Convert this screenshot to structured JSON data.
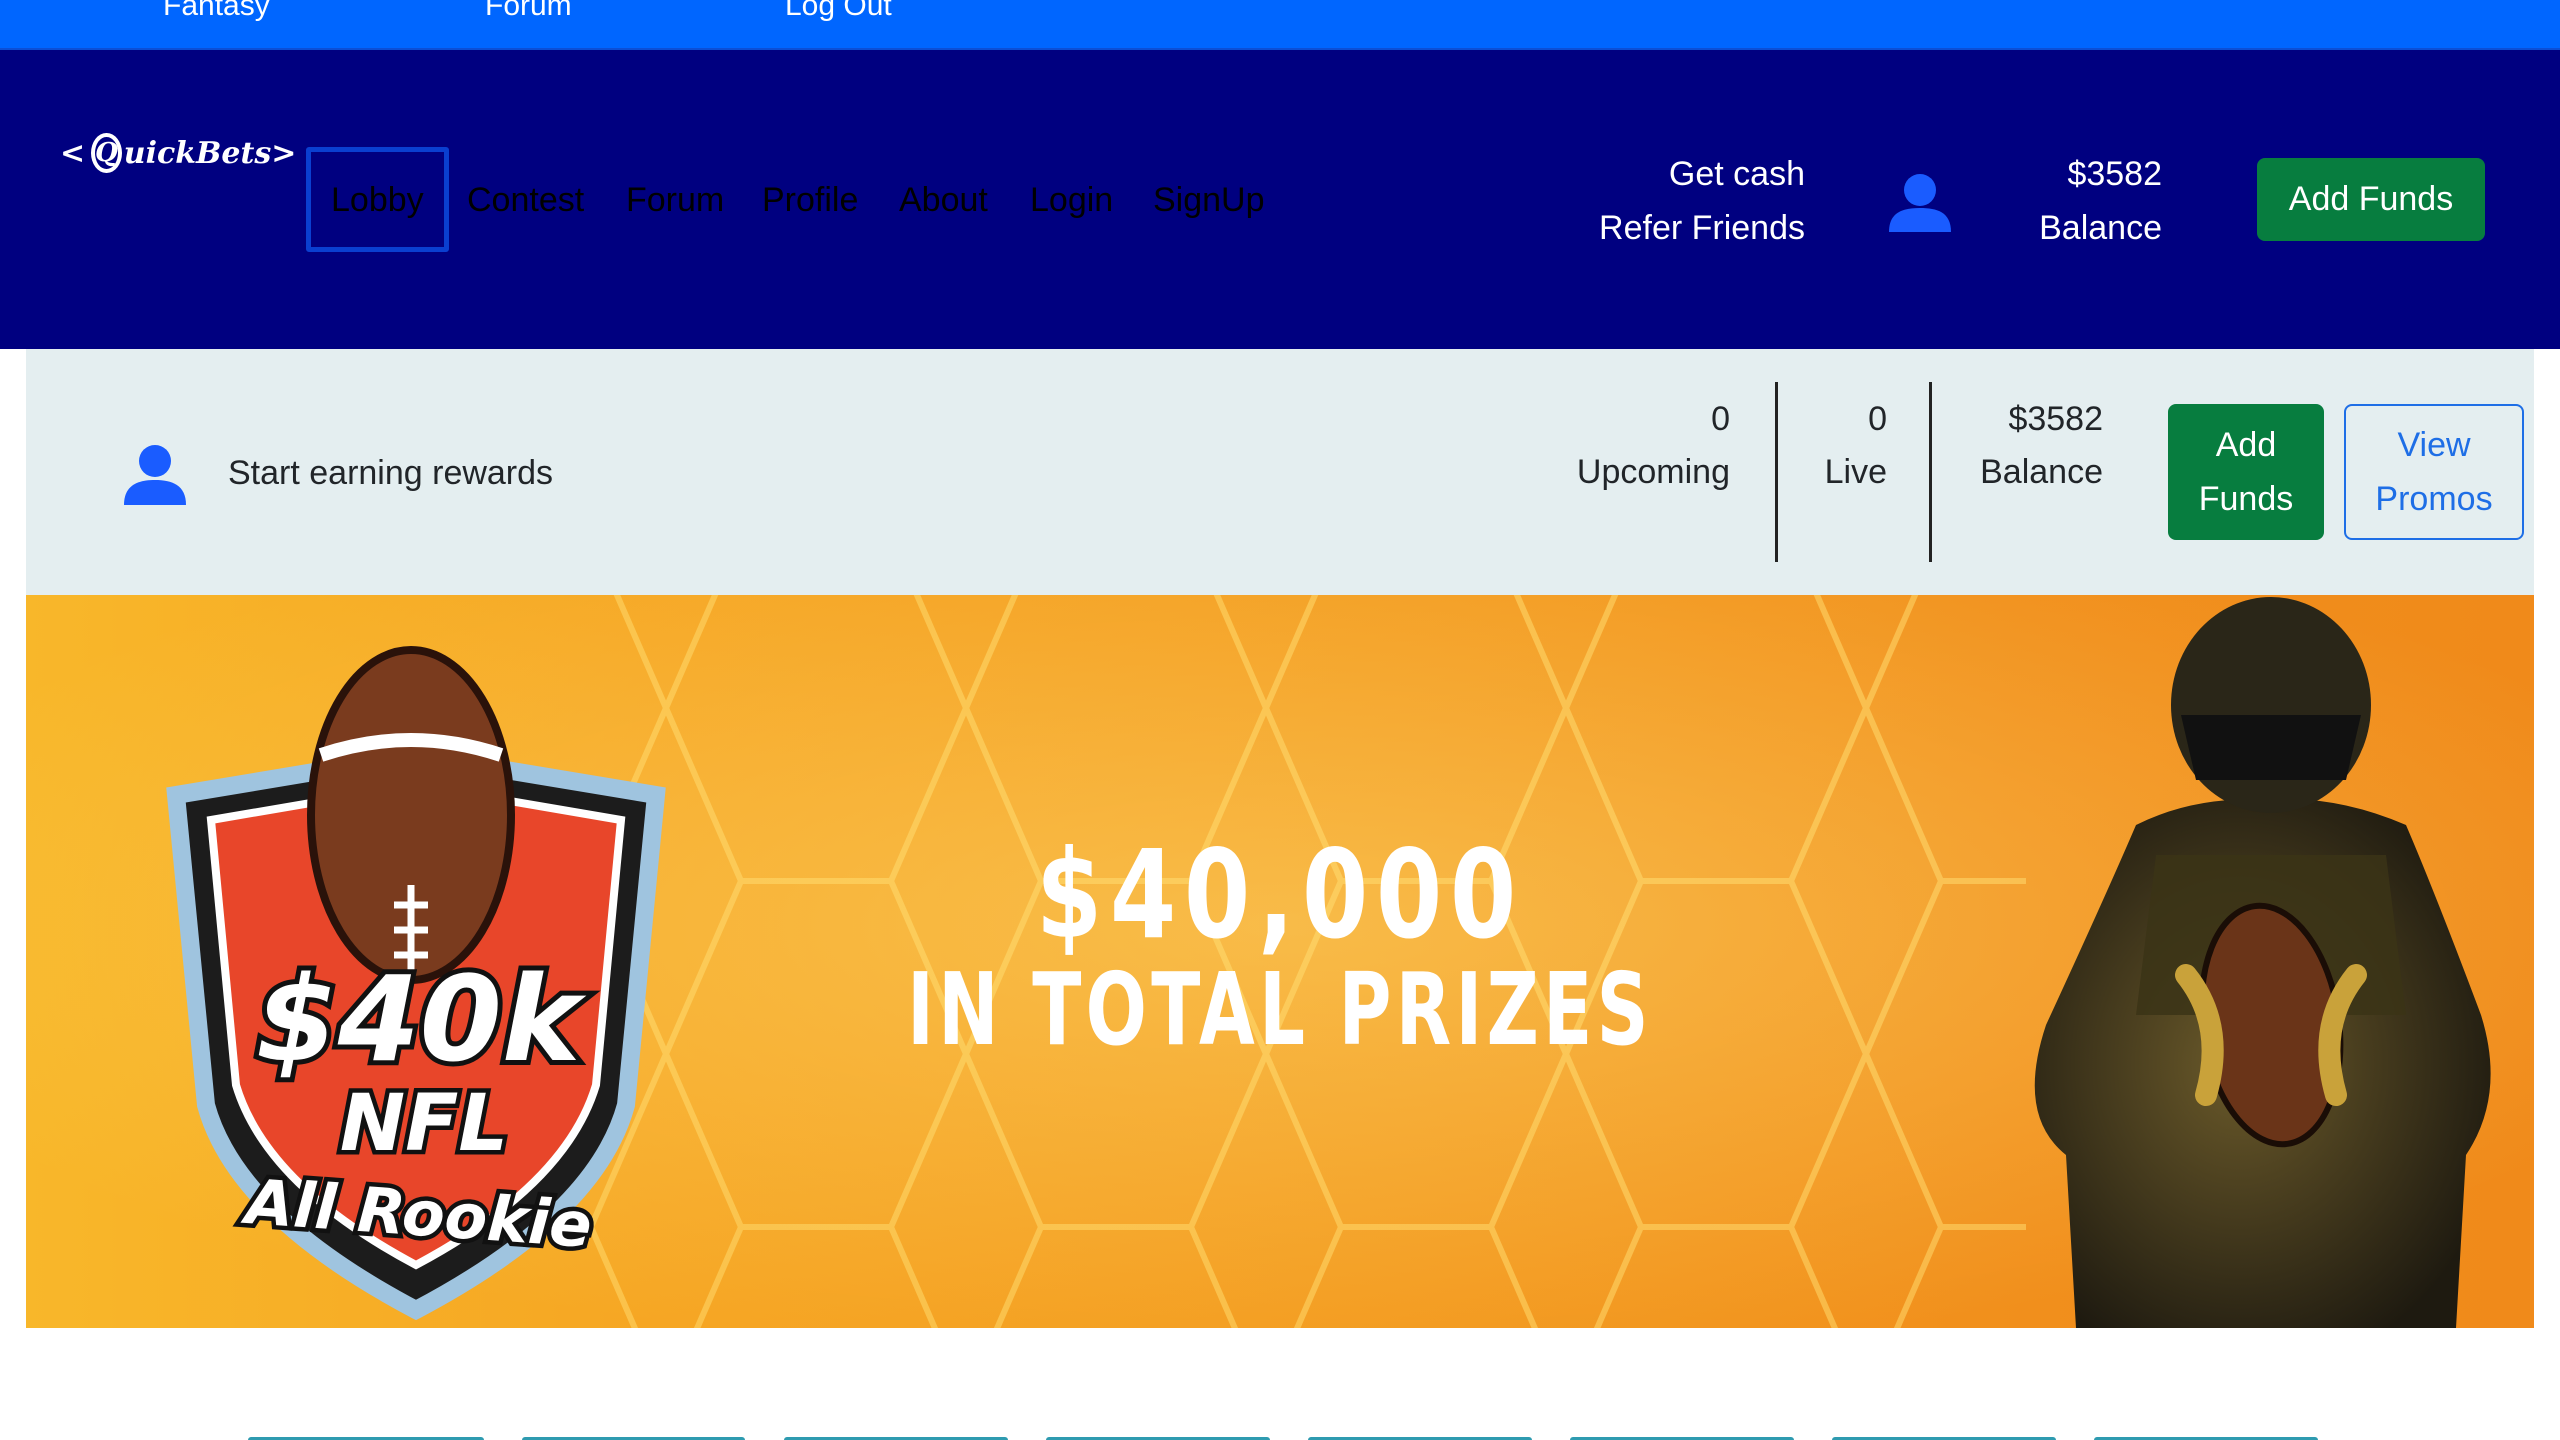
{
  "top_links": [
    "Fantasy",
    "Forum",
    "Log Out"
  ],
  "brand": {
    "logo_text_prefix": "",
    "logo_q": "Q",
    "logo_text": "uickBets"
  },
  "nav": {
    "links": [
      "Lobby",
      "Contest",
      "Forum",
      "Profile",
      "About",
      "Login",
      "SignUp"
    ],
    "referral_line1": "Get cash",
    "referral_line2": "Refer Friends",
    "balance_amount": "$3582",
    "balance_label": "Balance",
    "add_funds_label": "Add Funds"
  },
  "summary": {
    "rewards_text": "Start earning rewards",
    "upcoming_count": "0",
    "upcoming_label": "Upcoming",
    "live_count": "0",
    "live_label": "Live",
    "balance_amount": "$3582",
    "balance_label": "Balance",
    "add_funds_line1": "Add",
    "add_funds_line2": "Funds",
    "view_promos_line1": "View",
    "view_promos_line2": "Promos"
  },
  "banner": {
    "prize_amount": "$40,000",
    "prize_caption": "IN TOTAL PRIZES",
    "badge_line1": "$40k",
    "badge_line2": "NFL",
    "badge_line3": "All Rookie"
  },
  "colors": {
    "top_bar": "#0066ff",
    "nav_bar": "#000080",
    "accent_green": "#077d3f",
    "summary_bg": "#e4eef0",
    "banner_orange": "#f39a1f",
    "promo_blue": "#1e6ee6"
  },
  "icons": [
    "user-icon",
    "football-icon"
  ]
}
